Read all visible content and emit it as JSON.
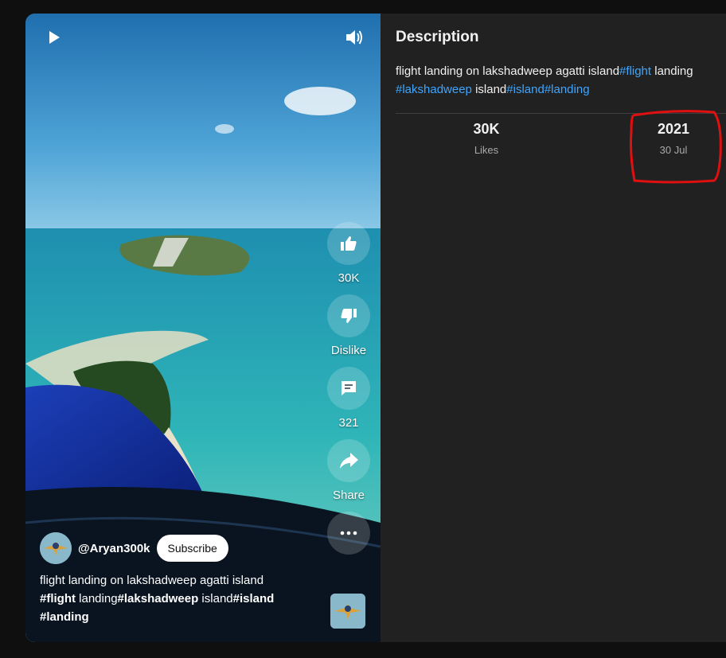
{
  "video": {
    "channel_handle": "@Aryan300k",
    "subscribe_label": "Subscribe",
    "caption_text": "flight landing on lakshadweep agatti island",
    "caption_tag_flight": "#flight",
    "caption_word_landing": " landing",
    "caption_tag_lakshadweep": "#lakshadweep",
    "caption_word_island": " island",
    "caption_tag_island": "#island",
    "caption_tag_landing": "#landing"
  },
  "actions": {
    "like_count": "30K",
    "dislike_label": "Dislike",
    "comment_count": "321",
    "share_label": "Share"
  },
  "description": {
    "title": "Description",
    "text_start": "flight landing on lakshadweep agatti island",
    "tag_flight": "#flight",
    "word_landing": " landing",
    "tag_lakshadweep": "#lakshadweep",
    "word_island": " island",
    "tag_island": "#island",
    "tag_landing": "#landing"
  },
  "stats": {
    "likes_value": "30K",
    "likes_label": "Likes",
    "year": "2021",
    "date": "30 Jul"
  },
  "colors": {
    "link": "#3ea6ff",
    "annotation": "#e01010"
  },
  "icons": [
    "play-icon",
    "volume-icon",
    "thumb-up-icon",
    "thumb-down-icon",
    "comment-icon",
    "share-icon",
    "more-icon"
  ]
}
